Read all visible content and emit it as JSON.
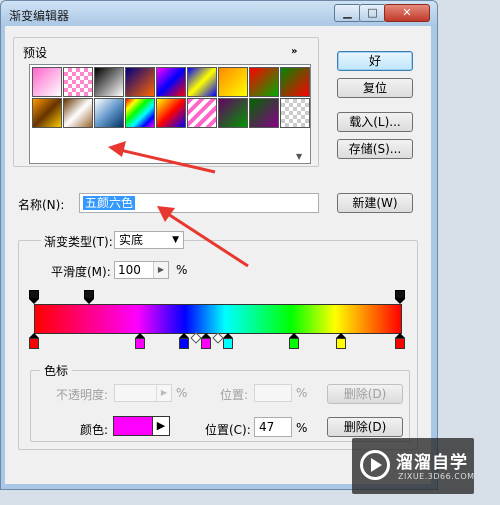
{
  "window": {
    "title": "渐变编辑器",
    "minimize_glyph": "▁",
    "maximize_glyph": "□",
    "close_glyph": "✕"
  },
  "presets": {
    "label": "预设",
    "menu_glyph": "»",
    "scroll_glyph": "▼",
    "swatches": [
      "linear-gradient(135deg,#ff66cc,#ffffff)",
      "repeating-conic-gradient(#ff88cc 0 25%,#ffffff 0 50%) 0 0/8px 8px",
      "linear-gradient(135deg,#000,#fff)",
      "linear-gradient(135deg,#000080,#ff6600)",
      "linear-gradient(135deg,#ff00ff,#0000ff,#ff0000)",
      "linear-gradient(135deg,#0000ff,#ffff00,#0000ff)",
      "linear-gradient(135deg,#ff8800,#ffff00)",
      "linear-gradient(135deg,#ff0000,#00aa00)",
      "linear-gradient(135deg,#008800,#ff0000)",
      "linear-gradient(135deg,#ff9900,#663300,#ffcc00)",
      "linear-gradient(135deg,#663300,#ffffff,#996633)",
      "linear-gradient(135deg,#ffffff,#6699cc,#003366)",
      "linear-gradient(135deg,#ff0000,#ffff00,#00ff00,#00ffff,#0000ff,#ff00ff)",
      "linear-gradient(135deg,#ffff00,#ff0000,#0000ff)",
      "repeating-linear-gradient(135deg,#ff66cc 0 4px,#ffffff 4px 8px)",
      "linear-gradient(135deg,#660066,#009900)",
      "linear-gradient(135deg,#006600,#880088)",
      "repeating-conic-gradient(#ccc 0 25%,#fff 0 50%) 0 0/8px 8px"
    ]
  },
  "buttons": {
    "ok": "好",
    "reset": "复位",
    "load": "载入(L)...",
    "save": "存储(S)...",
    "new": "新建(W)"
  },
  "name": {
    "label": "名称(N):",
    "value": "五颜六色"
  },
  "gradient": {
    "type_label": "渐变类型(T):",
    "type_value": "实底",
    "type_caret": "▼",
    "smooth_label": "平滑度(M):",
    "smooth_value": "100",
    "smooth_arrow": "▶",
    "smooth_unit": "%",
    "color_stops": [
      {
        "color": "#ff0000",
        "position": 0
      },
      {
        "color": "#ff00ff",
        "position": 29
      },
      {
        "color": "#0000ff",
        "position": 41
      },
      {
        "color": "#ff00ff",
        "position": 47
      },
      {
        "color": "#00ffff",
        "position": 53
      },
      {
        "color": "#00ff00",
        "position": 71
      },
      {
        "color": "#ffff00",
        "position": 84
      },
      {
        "color": "#ff0000",
        "position": 100
      }
    ],
    "opacity_stops": [
      {
        "position": 0
      },
      {
        "position": 15
      },
      {
        "position": 100
      }
    ],
    "midpoints": [
      {
        "position": 44
      },
      {
        "position": 50
      }
    ]
  },
  "stops": {
    "label": "色标",
    "opacity_label": "不透明度:",
    "opacity_unit": "%",
    "opacity_location_label": "位置:",
    "opacity_location_unit": "%",
    "delete_label": "删除(D)",
    "color_label": "颜色:",
    "color_value": "#ff00ff",
    "color_menu_glyph": "▶",
    "color_location_label": "位置(C):",
    "color_location_value": "47",
    "color_location_unit": "%",
    "color_delete_label": "删除(D)"
  },
  "watermark": {
    "text": "溜溜自学",
    "url": "ZIXUE.3D66.COM"
  }
}
